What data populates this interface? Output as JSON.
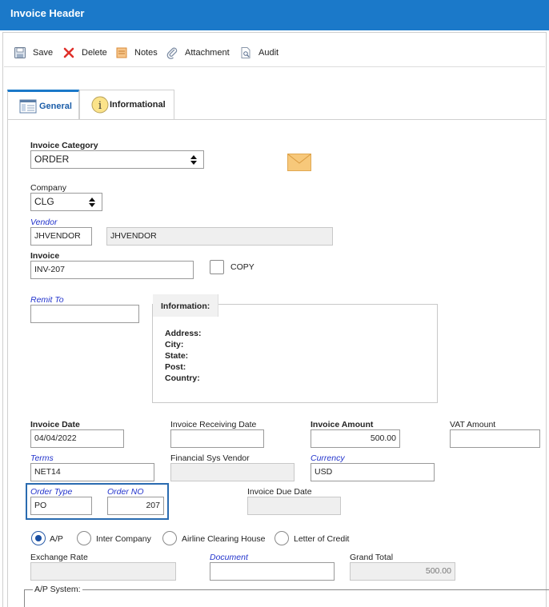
{
  "window": {
    "title": "Invoice Header"
  },
  "toolbar": {
    "save": "Save",
    "delete": "Delete",
    "notes": "Notes",
    "attachment": "Attachment",
    "audit": "Audit"
  },
  "tabs": [
    {
      "label": "General",
      "active": true
    },
    {
      "label": "Informational",
      "active": false
    }
  ],
  "form": {
    "invoice_category": {
      "label": "Invoice Category",
      "value": "ORDER"
    },
    "company": {
      "label": "Company",
      "value": "CLG"
    },
    "vendor": {
      "label": "Vendor",
      "code": "JHVENDOR",
      "name": "JHVENDOR"
    },
    "invoice": {
      "label": "Invoice",
      "value": "INV-207"
    },
    "copy": {
      "label": "COPY",
      "checked": false
    },
    "remit_to": {
      "label": "Remit To",
      "value": ""
    },
    "information": {
      "title": "Information:",
      "rows": [
        "Address:",
        "City:",
        "State:",
        "Post:",
        "Country:"
      ]
    },
    "invoice_date": {
      "label": "Invoice Date",
      "value": "04/04/2022"
    },
    "invoice_receiving_date": {
      "label": "Invoice Receiving Date",
      "value": ""
    },
    "invoice_amount": {
      "label": "Invoice Amount",
      "value": "500.00"
    },
    "vat_amount": {
      "label": "VAT Amount",
      "value": ""
    },
    "terms": {
      "label": "Terms",
      "value": "NET14"
    },
    "financial_sys_vendor": {
      "label": "Financial Sys Vendor",
      "value": ""
    },
    "currency": {
      "label": "Currency",
      "value": "USD"
    },
    "order_type": {
      "label": "Order Type",
      "value": "PO"
    },
    "order_no": {
      "label": "Order NO",
      "value": "207"
    },
    "invoice_due_date": {
      "label": "Invoice Due Date",
      "value": ""
    },
    "payment_type": {
      "options": [
        "A/P",
        "Inter Company",
        "Airline Clearing House",
        "Letter of Credit"
      ],
      "selected": "A/P"
    },
    "exchange_rate": {
      "label": "Exchange Rate",
      "value": ""
    },
    "document": {
      "label": "Document",
      "value": ""
    },
    "grand_total": {
      "label": "Grand Total",
      "value": "500.00"
    },
    "ap_system": {
      "label": "A/P System:"
    }
  },
  "colors": {
    "titlebar": "#1b79c9",
    "link_label": "#2233cc",
    "highlight_border": "#2a6bb0"
  },
  "icons": {
    "save": "floppy-disk-icon",
    "delete": "red-x-icon",
    "notes": "notepad-icon",
    "attachment": "paperclip-icon",
    "audit": "document-search-icon",
    "general_tab": "form-window-icon",
    "informational_tab": "info-circle-icon",
    "email": "envelope-icon"
  }
}
